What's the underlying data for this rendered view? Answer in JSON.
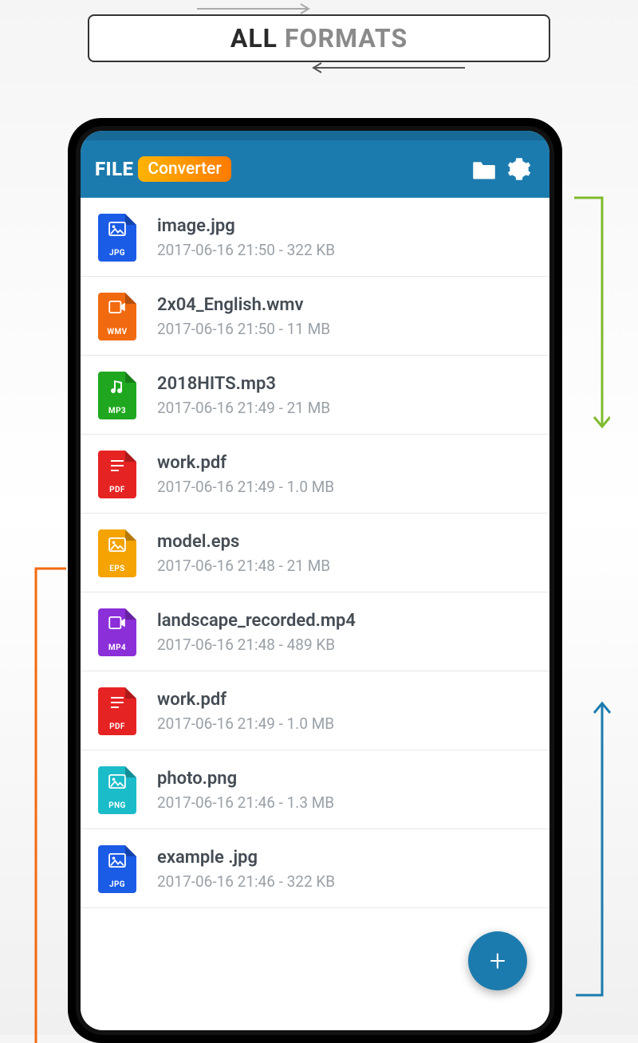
{
  "banner": {
    "word1": "ALL",
    "word2": "FORMATS"
  },
  "app": {
    "title_part1": "FILE",
    "title_part2": "Converter"
  },
  "fab": {
    "label": "+"
  },
  "files": [
    {
      "name": "image.jpg",
      "meta": "2017-06-16 21:50 - 322 KB",
      "ext": "JPG",
      "glyph": "image",
      "color": "#1b5ce6"
    },
    {
      "name": "2x04_English.wmv",
      "meta": "2017-06-16 21:50 - 11 MB",
      "ext": "WMV",
      "glyph": "video",
      "color": "#f26a0f"
    },
    {
      "name": "2018HITS.mp3",
      "meta": "2017-06-16 21:49 - 21 MB",
      "ext": "MP3",
      "glyph": "audio",
      "color": "#1fa81f"
    },
    {
      "name": "work.pdf",
      "meta": "2017-06-16 21:49 - 1.0 MB",
      "ext": "PDF",
      "glyph": "doc",
      "color": "#e62323"
    },
    {
      "name": "model.eps",
      "meta": "2017-06-16 21:48 - 21 MB",
      "ext": "EPS",
      "glyph": "image",
      "color": "#f4a300"
    },
    {
      "name": "landscape_recorded.mp4",
      "meta": "2017-06-16 21:48 - 489 KB",
      "ext": "MP4",
      "glyph": "video",
      "color": "#8b2fd9"
    },
    {
      "name": "work.pdf",
      "meta": "2017-06-16 21:49 - 1.0 MB",
      "ext": "PDF",
      "glyph": "doc",
      "color": "#e62323"
    },
    {
      "name": "photo.png",
      "meta": "2017-06-16 21:46 - 1.3 MB",
      "ext": "PNG",
      "glyph": "image",
      "color": "#1bbcc9"
    },
    {
      "name": "example .jpg",
      "meta": "2017-06-16 21:46 - 322 KB",
      "ext": "JPG",
      "glyph": "image",
      "color": "#1b5ce6"
    }
  ]
}
